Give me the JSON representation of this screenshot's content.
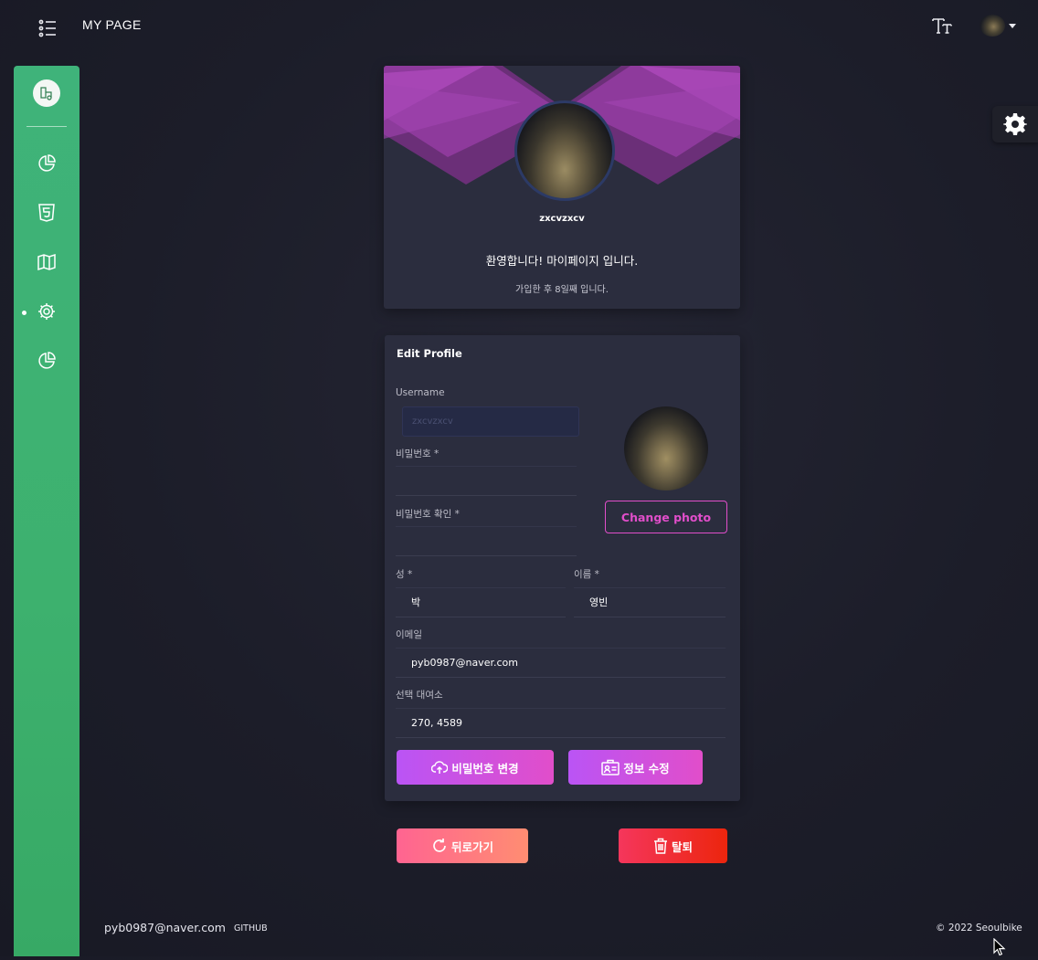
{
  "header": {
    "title": "MY PAGE",
    "menu_icon": "list-icon",
    "text_size_icon": "text-size-icon",
    "avatar_icon": "user-avatar"
  },
  "sidebar": {
    "logo_icon": "bike-logo-icon",
    "items": [
      {
        "icon": "pie-chart-icon"
      },
      {
        "icon": "html5-icon"
      },
      {
        "icon": "map-icon"
      },
      {
        "icon": "gear-icon",
        "active": true
      },
      {
        "icon": "pie-chart-icon"
      }
    ],
    "color": "#3db16e"
  },
  "settings_tab": {
    "icon": "gear-icon"
  },
  "profile": {
    "name": "zxcvzxcv",
    "welcome": "환영합니다! 마이페이지 입니다.",
    "joined": "가입한 후 8일째 입니다."
  },
  "edit_profile": {
    "title": "Edit Profile",
    "username_label": "Username",
    "username_placeholder": "zxcvzxcv",
    "password_label": "비밀번호 *",
    "password_confirm_label": "비밀번호 확인 *",
    "last_name_label": "성 *",
    "last_name_value": "박",
    "first_name_label": "이름 *",
    "first_name_value": "영빈",
    "email_label": "이메일",
    "email_value": "pyb0987@naver.com",
    "station_label": "선택 대여소",
    "station_value": "270, 4589",
    "change_photo": "Change photo",
    "change_password_button": "비밀번호 변경",
    "update_info_button": "정보 수정"
  },
  "actions": {
    "back_button": "뒤로가기",
    "delete_button": "탈퇴"
  },
  "footer": {
    "email": "pyb0987@naver.com",
    "github": "GITHUB",
    "copyright": "© 2022 Seoulbike"
  },
  "colors": {
    "accent_purple": "#e14eca",
    "accent_red": "#f5365c",
    "accent_orange": "#ff8d72",
    "sidebar_green": "#3db16e",
    "card_bg": "#2b2d3e"
  }
}
